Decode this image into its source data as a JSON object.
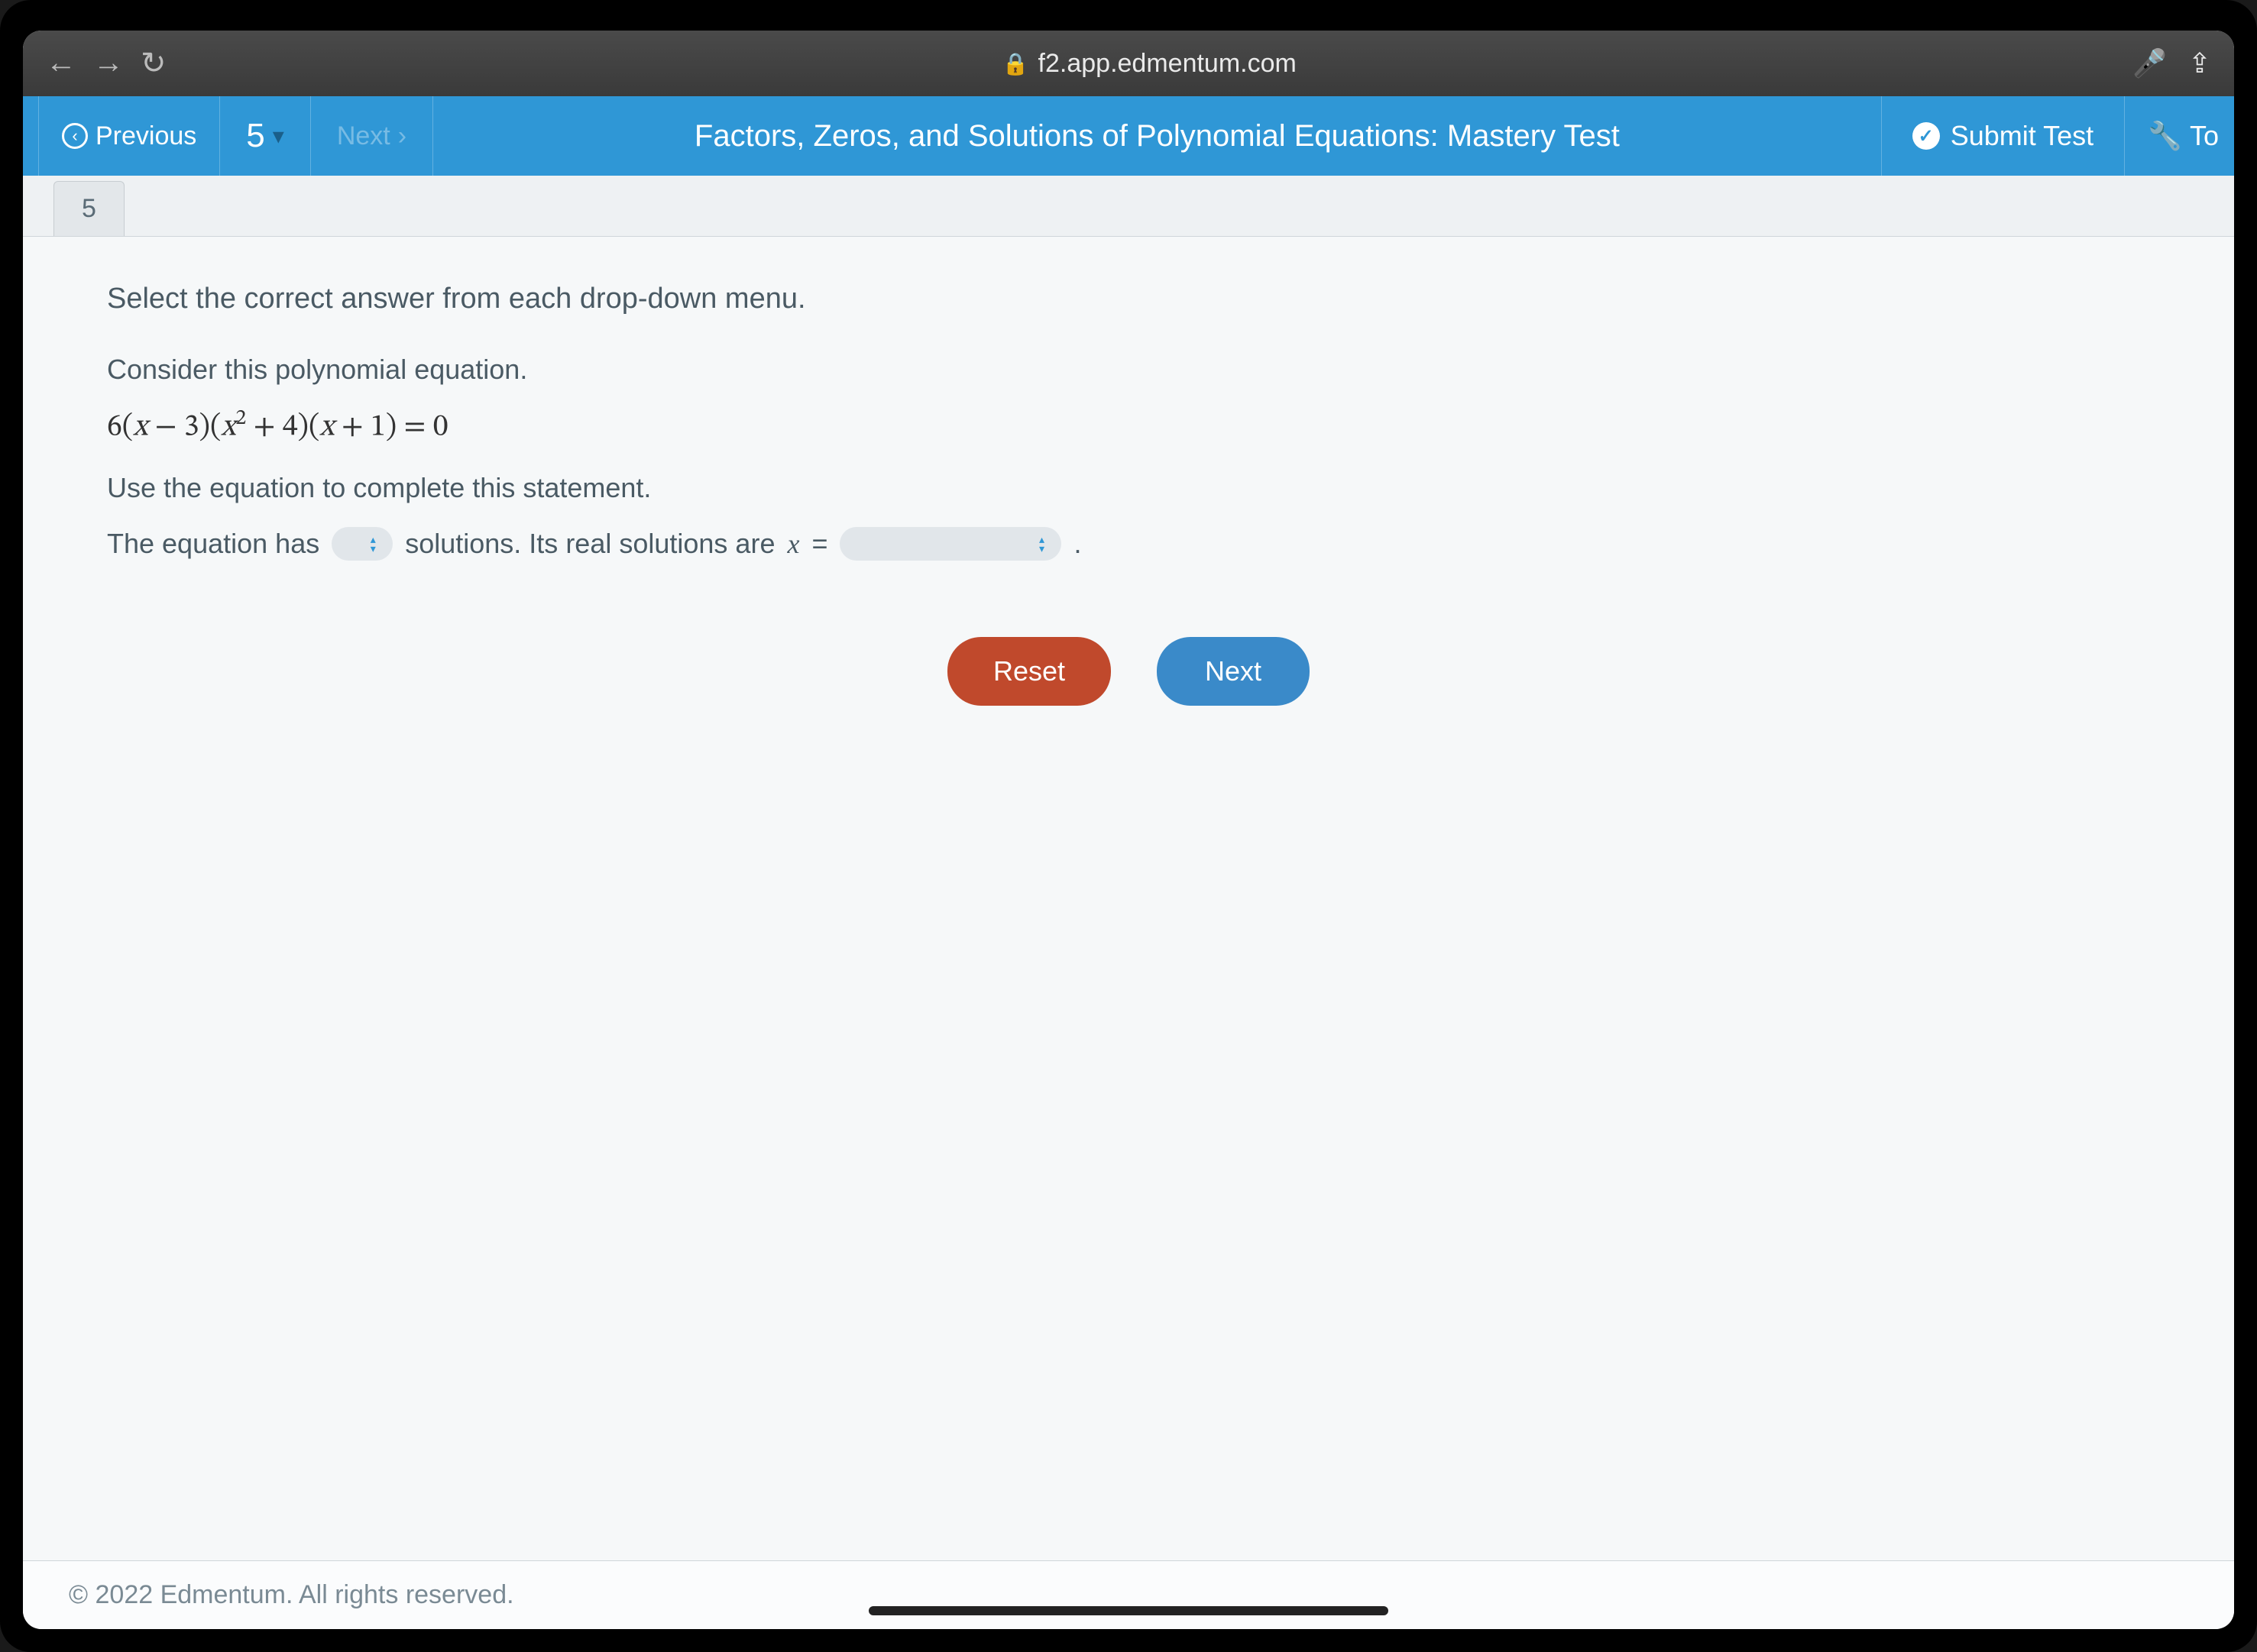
{
  "browser": {
    "url": "f2.app.edmentum.com"
  },
  "header": {
    "previous": "Previous",
    "next": "Next",
    "question_number": "5",
    "title": "Factors, Zeros, and Solutions of Polynomial Equations: Mastery Test",
    "submit": "Submit Test",
    "tools": "To"
  },
  "tab": {
    "label": "5"
  },
  "question": {
    "instruction": "Select the correct answer from each drop-down menu.",
    "line1": "Consider this polynomial equation.",
    "equation_plain": "6(x − 3)(x² + 4)(x + 1) = 0",
    "line2": "Use the equation to complete this statement.",
    "stmt_a": "The equation has",
    "stmt_b": "solutions. Its real solutions are",
    "var": "x",
    "eq": "=",
    "period": "."
  },
  "buttons": {
    "reset": "Reset",
    "next": "Next"
  },
  "footer": {
    "copyright": "© 2022 Edmentum. All rights reserved."
  }
}
